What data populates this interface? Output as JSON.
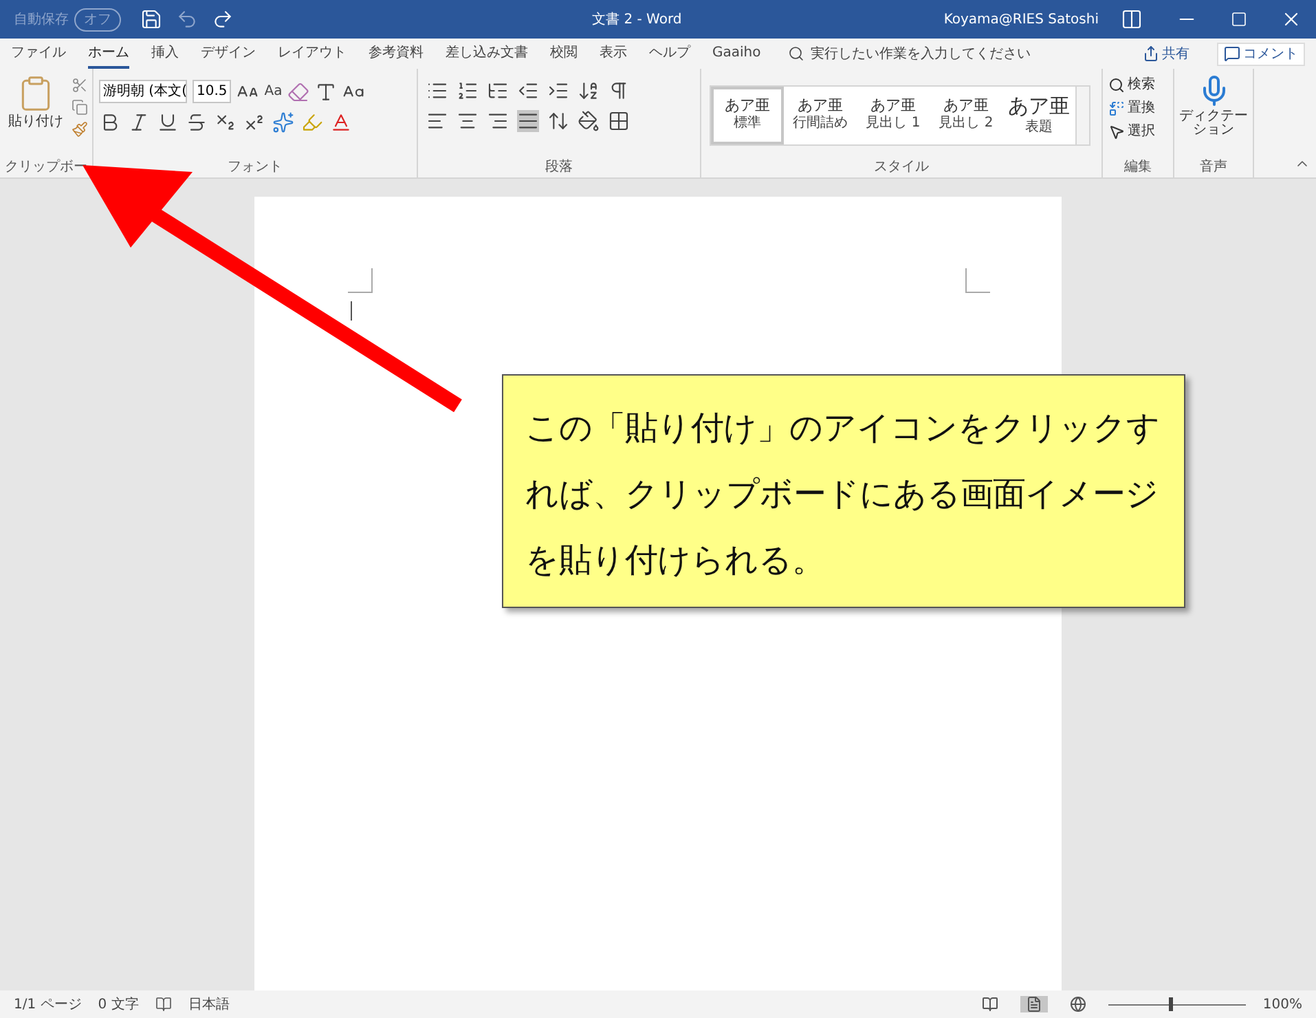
{
  "title_bar": {
    "autosave_label": "自動保存",
    "autosave_state": "オフ",
    "autosave_on": false,
    "title": "文書 2 - Word",
    "user": "Koyama@RIES Satoshi"
  },
  "tabs": [
    {
      "label": "ファイル",
      "selected": false
    },
    {
      "label": "ホーム",
      "selected": true
    },
    {
      "label": "挿入",
      "selected": false
    },
    {
      "label": "デザイン",
      "selected": false
    },
    {
      "label": "レイアウト",
      "selected": false
    },
    {
      "label": "参考資料",
      "selected": false
    },
    {
      "label": "差し込み文書",
      "selected": false
    },
    {
      "label": "校閲",
      "selected": false
    },
    {
      "label": "表示",
      "selected": false
    },
    {
      "label": "ヘルプ",
      "selected": false
    },
    {
      "label": "Gaaiho",
      "selected": false
    }
  ],
  "tell_me": {
    "placeholder": "実行したい作業を入力してください"
  },
  "share": "共有",
  "comment": "コメント",
  "ribbon": {
    "clipboard": {
      "paste": "貼り付け",
      "label": "クリップボー"
    },
    "font": {
      "name": "游明朝 (本文(",
      "size": "10.5",
      "case": "Aa",
      "label": "フォント"
    },
    "paragraph": {
      "label": "段落"
    },
    "styles": {
      "items": [
        {
          "sample": "あア亜",
          "name": "標準",
          "selected": true
        },
        {
          "sample": "あア亜",
          "name": "行間詰め",
          "selected": false
        },
        {
          "sample": "あア亜",
          "name": "見出し 1",
          "selected": false
        },
        {
          "sample": "あア亜",
          "name": "見出し 2",
          "selected": false
        },
        {
          "sample": "あア亜",
          "name": "表題",
          "selected": false
        }
      ],
      "label": "スタイル"
    },
    "editing": {
      "find": "検索",
      "replace": "置換",
      "select": "選択",
      "label": "編集"
    },
    "voice": {
      "dictate": "ディクテーション",
      "label": "音声"
    }
  },
  "callout": "この「貼り付け」のアイコンをクリックすれば、クリップボードにある画面イメージを貼り付けられる。",
  "status_bar": {
    "page": "1/1 ページ",
    "words": "0 文字",
    "language": "日本語",
    "views": [
      {
        "kind": "read",
        "selected": false
      },
      {
        "kind": "print",
        "selected": true
      },
      {
        "kind": "web",
        "selected": false
      }
    ],
    "zoom": {
      "level": 0.45,
      "reading": "100%"
    }
  }
}
